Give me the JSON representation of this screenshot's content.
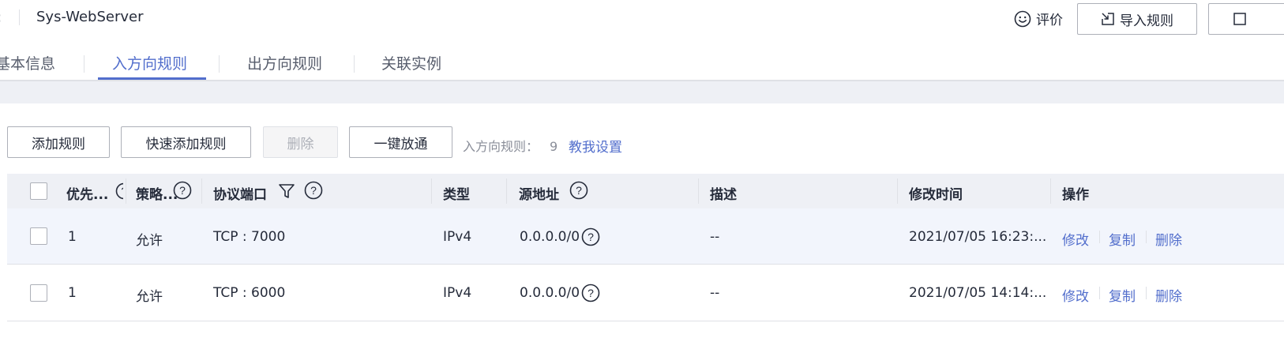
{
  "header": {
    "title": "Sys-WebServer",
    "rate_label": "评价",
    "import_label": "导入规则",
    "back_icon": "chevron-left-icon",
    "rate_icon": "smile-icon",
    "import_icon": "import-icon"
  },
  "tabs": [
    {
      "label": "基本信息",
      "active": false
    },
    {
      "label": "入方向规则",
      "active": true
    },
    {
      "label": "出方向规则",
      "active": false
    },
    {
      "label": "关联实例",
      "active": false
    }
  ],
  "toolbar": {
    "add_label": "添加规则",
    "quick_add_label": "快速添加规则",
    "delete_label": "删除",
    "one_click_label": "一键放通",
    "count_label": "入方向规则：",
    "count_value": "9",
    "help_link": "教我设置"
  },
  "table": {
    "headers": {
      "priority": "优先...",
      "policy": "策略...",
      "protocol_port": "协议端口",
      "type": "类型",
      "source": "源地址",
      "description": "描述",
      "modified": "修改时间",
      "actions": "操作"
    },
    "rows": [
      {
        "priority": "1",
        "policy": "允许",
        "protocol_port": "TCP : 7000",
        "type": "IPv4",
        "source": "0.0.0.0/0",
        "description": "--",
        "modified": "2021/07/05 16:23:...",
        "actions": [
          "修改",
          "复制",
          "删除"
        ]
      },
      {
        "priority": "1",
        "policy": "允许",
        "protocol_port": "TCP : 6000",
        "type": "IPv4",
        "source": "0.0.0.0/0",
        "description": "--",
        "modified": "2021/07/05 14:14:...",
        "actions": [
          "修改",
          "复制",
          "删除"
        ]
      }
    ]
  },
  "colors": {
    "accent": "#526ecc",
    "header_bg": "#eef0f5",
    "hover_row_bg": "#f2f5fc",
    "border": "#adb0b8"
  }
}
